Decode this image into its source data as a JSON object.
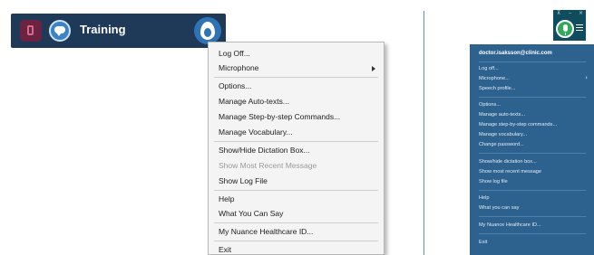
{
  "left_bar": {
    "title": "Training",
    "mic_icon": "microphone-off-icon",
    "chat_icon": "chat-bubble-icon",
    "dragon_icon": "dragon-flame-icon"
  },
  "ctx_menu": {
    "items": [
      "Log Off...",
      "Microphone",
      "Options...",
      "Manage Auto-texts...",
      "Manage Step-by-step Commands...",
      "Manage Vocabulary...",
      "Show/Hide Dictation Box...",
      "Show Most Recent Message",
      "Show Log File",
      "Help",
      "What You Can Say",
      "My Nuance Healthcare ID...",
      "Exit"
    ]
  },
  "right_bar": {
    "pin_glyph": "⊼",
    "min_glyph": "–",
    "close_glyph": "×",
    "mic_icon": "microphone-on-icon",
    "menu_icon": "hamburger-menu-icon"
  },
  "right_menu": {
    "email": "doctor.isaksson@clinic.com",
    "items": [
      "Log off...",
      "Microphone...",
      "Speech profile...",
      "Options...",
      "Manage auto-texts...",
      "Manage step-by-step commands...",
      "Manage vocabulary...",
      "Change password...",
      "Show/hide dictation box...",
      "Show most recent message",
      "Show log file",
      "Help",
      "What you can say",
      "My Nuance Healthcare ID...",
      "Exit"
    ]
  },
  "colors": {
    "bar_bg": "#1f3a58",
    "menu_bg": "#f4f4f4",
    "right_menu_bg": "#2d628f",
    "mic_green": "#31a85a",
    "divider": "#5b8fcc"
  }
}
